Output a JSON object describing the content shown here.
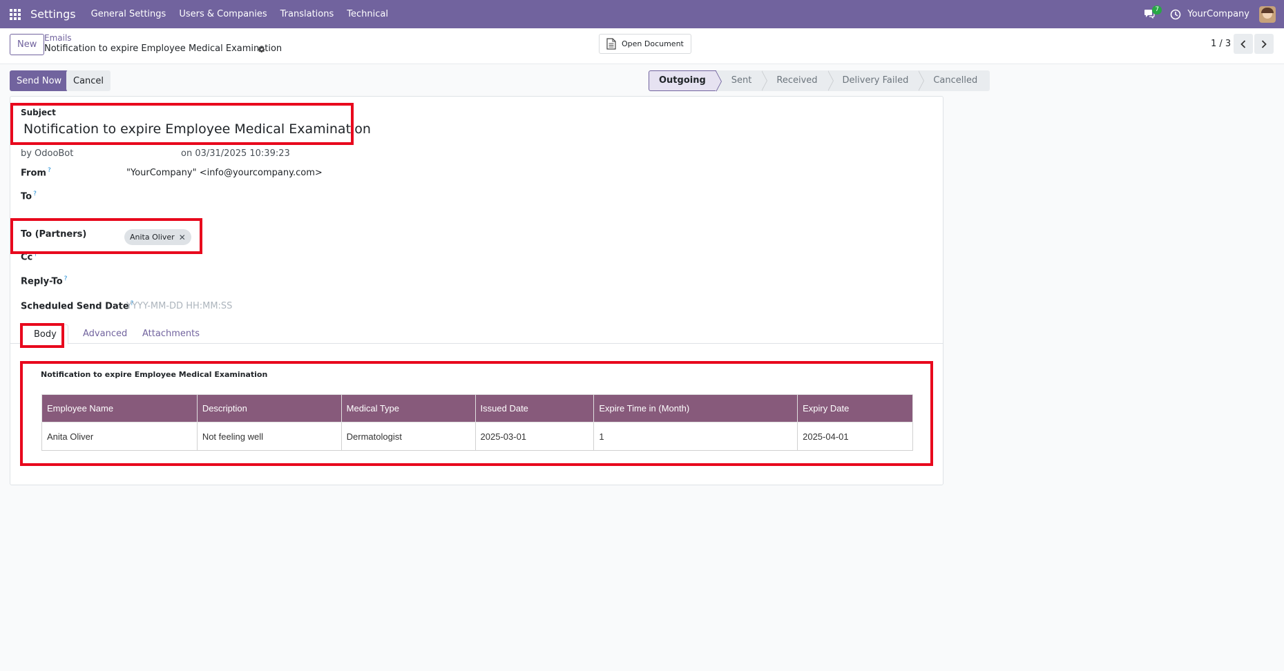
{
  "navbar": {
    "app_name": "Settings",
    "menu": [
      "General Settings",
      "Users & Companies",
      "Translations",
      "Technical"
    ],
    "chat_badge": "7",
    "company": "YourCompany"
  },
  "control_panel": {
    "new_label": "New",
    "breadcrumb_parent": "Emails",
    "breadcrumb_current": "Notification to expire Employee Medical Examination",
    "open_document_label": "Open Document",
    "pager": "1 / 3"
  },
  "actions": {
    "send_now": "Send Now",
    "cancel": "Cancel"
  },
  "statusbar": [
    "Outgoing",
    "Sent",
    "Received",
    "Delivery Failed",
    "Cancelled"
  ],
  "statusbar_active": "Outgoing",
  "form": {
    "subject_label": "Subject",
    "subject": "Notification to expire Employee Medical Examination",
    "by_label": "by",
    "author": "OdooBot",
    "date": "on 03/31/2025 10:39:23",
    "from_label": "From",
    "from_value": "\"YourCompany\" <info@yourcompany.com>",
    "to_label": "To",
    "to_partners_label": "To (Partners)",
    "partner_tag": "Anita Oliver",
    "cc_label": "Cc",
    "reply_to_label": "Reply-To",
    "scheduled_label": "Scheduled Send Date",
    "scheduled_placeholder": "YYYY-MM-DD HH:MM:SS",
    "help_mark": "?"
  },
  "tabs": [
    "Body",
    "Advanced",
    "Attachments"
  ],
  "body": {
    "heading": "Notification to expire Employee Medical Examination",
    "columns": [
      "Employee Name",
      "Description",
      "Medical Type",
      "Issued Date",
      "Expire Time in (Month)",
      "Expiry Date"
    ],
    "rows": [
      [
        "Anita Oliver",
        "Not feeling well",
        "Dermatologist",
        "2025-03-01",
        "1",
        "2025-04-01"
      ]
    ]
  },
  "colors": {
    "brand": "#71639e",
    "table_header": "#875a7b",
    "highlight": "#e8081d",
    "badge": "#28a745"
  }
}
